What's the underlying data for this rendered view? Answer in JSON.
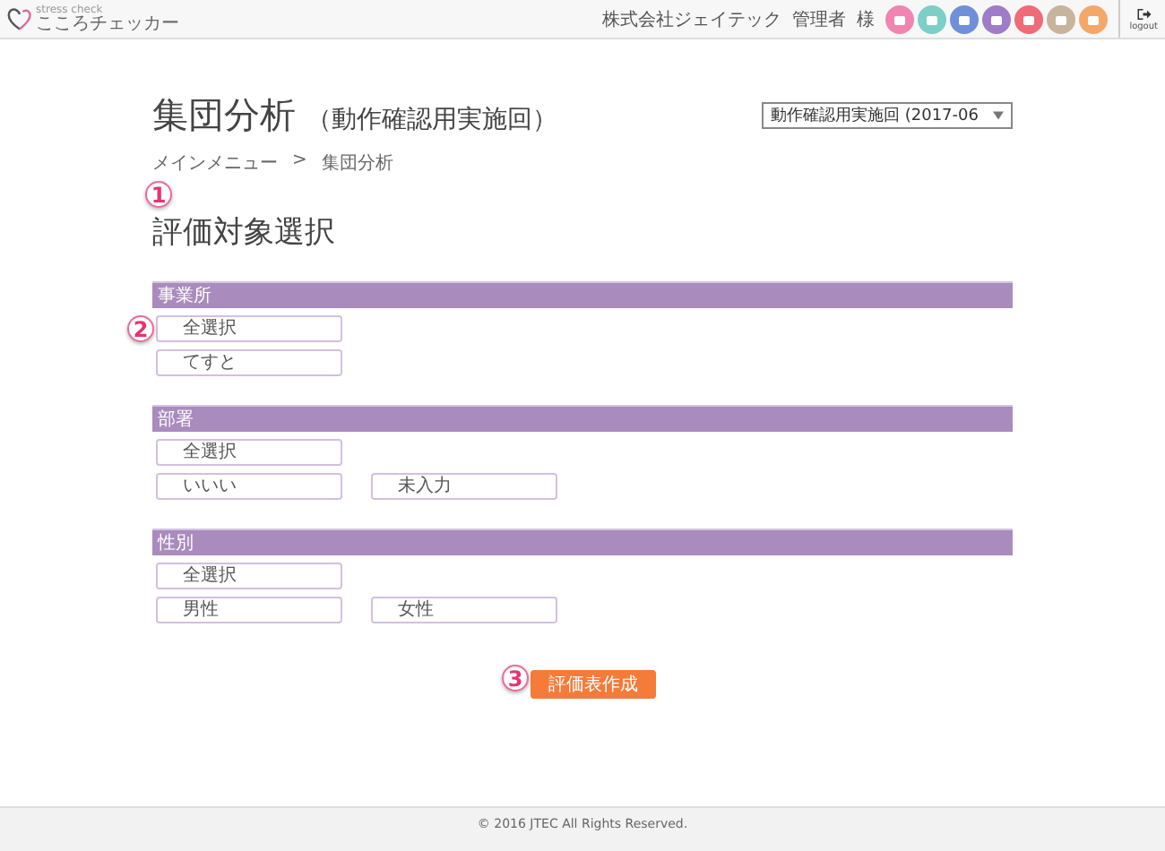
{
  "header": {
    "logo_tagline": "stress check",
    "logo": "こころチェッカー",
    "company": "株式会社ジェイテック",
    "user": "管理者",
    "honorific": "様",
    "logout": "logout"
  },
  "page": {
    "title": "集団分析",
    "subtitle": "（動作確認用実施回）",
    "period_select": {
      "value": "動作確認用実施回 (2017-06"
    },
    "breadcrumb": {
      "items": [
        "メインメニュー",
        "集団分析"
      ],
      "separator": ">"
    }
  },
  "section": {
    "marker": "1",
    "title": "評価対象選択"
  },
  "groups": [
    {
      "title": "事業所",
      "select_all": {
        "label": "全選択",
        "selected": false,
        "marker": "2"
      },
      "options": [
        {
          "label": "てすと",
          "selected": false
        }
      ]
    },
    {
      "title": "部署",
      "select_all": {
        "label": "全選択",
        "selected": false
      },
      "options": [
        {
          "label": "いいい",
          "selected": false
        },
        {
          "label": "未入力",
          "selected": false
        }
      ]
    },
    {
      "title": "性別",
      "select_all": {
        "label": "全選択",
        "selected": false
      },
      "options": [
        {
          "label": "男性",
          "selected": false
        },
        {
          "label": "女性",
          "selected": false
        }
      ]
    }
  ],
  "action": {
    "label": "評価表作成",
    "marker": "3"
  },
  "footer": {
    "copyright": "© 2016 JTEC All Rights Reserved."
  }
}
